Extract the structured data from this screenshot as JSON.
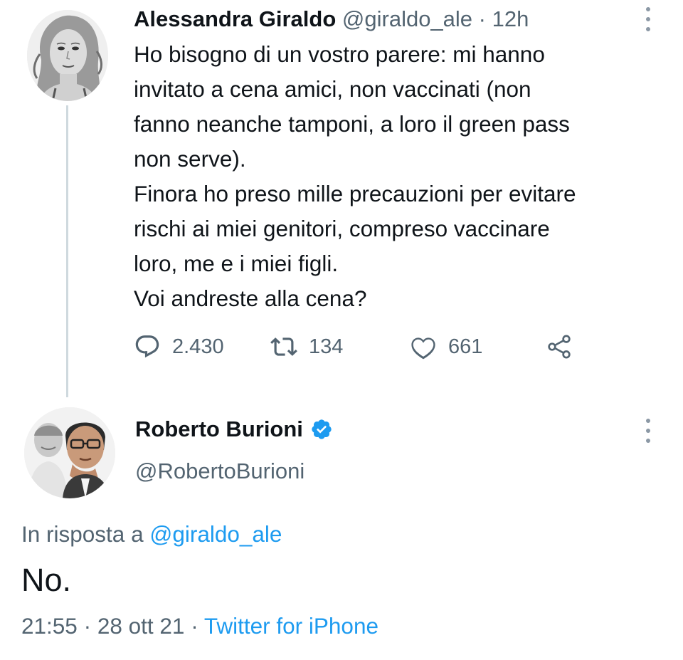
{
  "tweet1": {
    "author_name": "Alessandra Giraldo",
    "handle": "@giraldo_ale",
    "separator": " · ",
    "time": "12h",
    "text": "Ho bisogno di un vostro parere: mi hanno\ninvitato a cena amici, non vaccinati (non\nfanno neanche tamponi, a loro il green pass\nnon serve).\nFinora ho preso mille precauzioni per evitare\nrischi ai miei genitori, compreso vaccinare\nloro, me e i miei figli.\nVoi andreste alla cena?",
    "actions": {
      "reply_count": "2.430",
      "retweet_count": "134",
      "like_count": "661"
    },
    "avatar_icon": "profile-photo-woman",
    "more_icon": "more-vertical-icon"
  },
  "tweet2": {
    "author_name": "Roberto Burioni",
    "verified_icon": "verified-badge-icon",
    "handle": "@RobertoBurioni",
    "reply_prefix": "In risposta a ",
    "reply_to_handle": "@giraldo_ale",
    "text": "No.",
    "time": "21:55",
    "separator": " · ",
    "date": "28 ott 21",
    "separator2": " · ",
    "source": "Twitter for iPhone",
    "avatar_icon": "profile-photo-man",
    "more_icon": "more-vertical-icon"
  },
  "colors": {
    "text": "#0f1419",
    "secondary": "#536471",
    "link": "#1d9bf0",
    "thread_line": "#cfd9de"
  }
}
